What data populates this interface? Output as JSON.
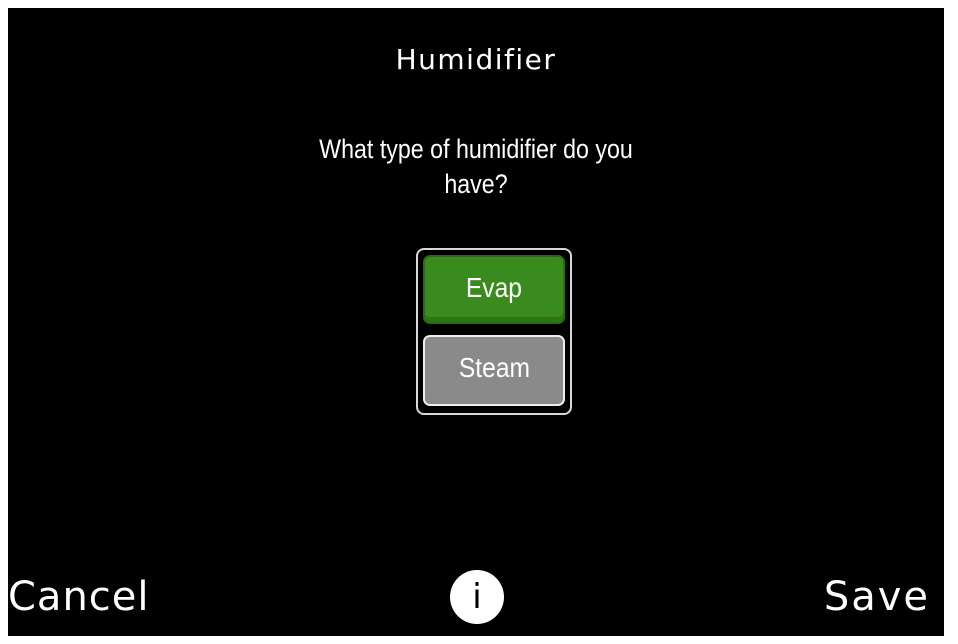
{
  "header": {
    "title": "Humidifier"
  },
  "prompt": {
    "line1": "What type of humidifier do you",
    "line2": "have?"
  },
  "options": {
    "items": [
      {
        "label": "Evap",
        "selected": true
      },
      {
        "label": "Steam",
        "selected": false
      }
    ]
  },
  "footer": {
    "cancel_label": "Cancel",
    "info_glyph": "i",
    "save_label": "Save"
  },
  "colors": {
    "background": "#000000",
    "selected_option": "#3a8b1d",
    "unselected_option": "#8a8a8a",
    "text": "#ffffff"
  },
  "icons": {
    "info": "info-icon"
  }
}
